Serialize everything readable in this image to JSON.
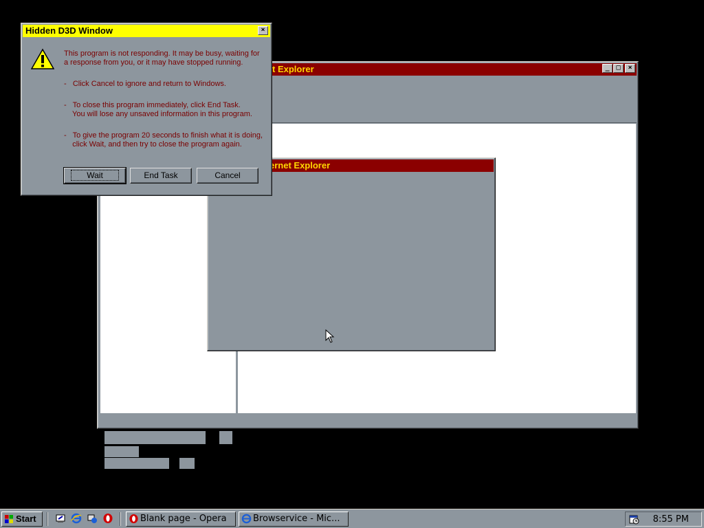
{
  "colors": {
    "desktop": "#000000",
    "window_face": "#8d969e",
    "ie_title_bg": "#8b0000",
    "ie_title_fg": "#ffd700",
    "dialog_title_bg": "#ffff00",
    "dialog_text": "#7a0000"
  },
  "ie_back": {
    "title": "Browservice - Microsoft Internet Explorer",
    "title_visible": "t Explorer",
    "buttons": [
      "minimize",
      "maximize",
      "close"
    ]
  },
  "ie_mid": {
    "title_visible": "ernet Explorer"
  },
  "dialog": {
    "title": "Hidden D3D Window",
    "icon": "warning-icon",
    "message_1": "This program is not responding. It may be busy, waiting for\na response from you, or it may have stopped running.",
    "message_2": "-   Click Cancel to ignore and return to Windows.",
    "message_3": "-   To close this program immediately, click End Task.\n    You will lose any unsaved information in this program.",
    "message_4": "-   To give the program 20 seconds to finish what it is doing,\n    click Wait, and then try to close the program again.",
    "wait_label": "Wait",
    "end_task_label": "End Task",
    "cancel_label": "Cancel"
  },
  "taskbar": {
    "start_label": "Start",
    "quick_launch": [
      "desktop-icon",
      "ie-icon",
      "channels-icon",
      "opera-icon"
    ],
    "tasks": [
      {
        "label": "Blank page - Opera",
        "icon": "opera-icon"
      },
      {
        "label": "Browservice - Mic...",
        "icon": "ie-icon"
      }
    ],
    "clock": "8:55 PM",
    "tray_icon": "scheduler-icon"
  }
}
